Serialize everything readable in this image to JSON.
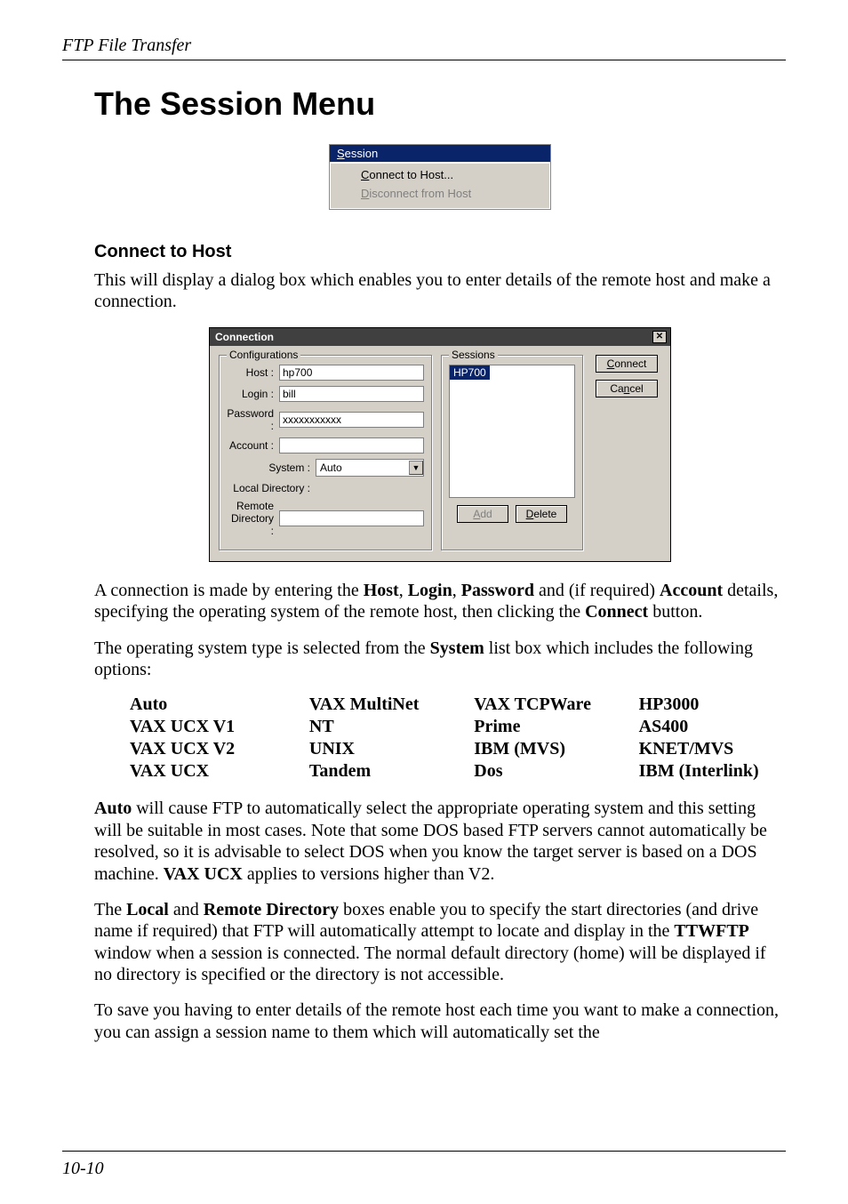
{
  "header": {
    "running": "FTP File Transfer"
  },
  "title": "The Session Menu",
  "menu": {
    "label": "Session",
    "items": [
      {
        "label_pre": "",
        "accel": "C",
        "label_post": "onnect to Host...",
        "disabled": false
      },
      {
        "label_pre": "",
        "accel": "D",
        "label_post": "isconnect from Host",
        "disabled": true
      }
    ]
  },
  "section1": {
    "heading": "Connect to Host",
    "intro": "This will display a dialog box which enables you to enter details of the remote host and make a connection."
  },
  "dialog": {
    "title": "Connection",
    "configurations_legend": "Configurations",
    "sessions_legend": "Sessions",
    "host_label": "Host :",
    "host_value": "hp700",
    "login_label": "Login :",
    "login_value": "bill",
    "password_label": "Password :",
    "password_value": "xxxxxxxxxxx",
    "account_label": "Account :",
    "account_value": "",
    "system_label": "System :",
    "system_value": "Auto",
    "localdir_label": "Local Directory :",
    "localdir_value": "",
    "remotedir_label": "Remote Directory :",
    "remotedir_value": "",
    "session_item": "HP700",
    "btn_add_pre": "",
    "btn_add_accel": "A",
    "btn_add_post": "dd",
    "btn_delete_pre": "",
    "btn_delete_accel": "D",
    "btn_delete_post": "elete",
    "btn_connect_pre": "",
    "btn_connect_accel": "C",
    "btn_connect_post": "onnect",
    "btn_cancel_pre": "Ca",
    "btn_cancel_accel": "n",
    "btn_cancel_post": "cel"
  },
  "para2": "A connection is made by entering the ",
  "para2_b1": "Host",
  "para2_m1": ", ",
  "para2_b2": "Login",
  "para2_m2": ", ",
  "para2_b3": "Password",
  "para2_m3": " and (if required) ",
  "para2_b4": "Account",
  "para2_m4": " details, specifying the operating system of the remote host, then clicking the ",
  "para2_b5": "Connect",
  "para2_m5": " button.",
  "para3a": "The operating system type is selected from the ",
  "para3b": "System",
  "para3c": " list box which includes the following options:",
  "options": {
    "r0": [
      "Auto",
      "VAX MultiNet",
      "VAX TCPWare",
      "HP3000"
    ],
    "r1": [
      "VAX UCX V1",
      "NT",
      "Prime",
      "AS400"
    ],
    "r2": [
      "VAX UCX V2",
      "UNIX",
      "IBM (MVS)",
      "KNET/MVS"
    ],
    "r3": [
      "VAX UCX",
      "Tandem",
      "Dos",
      "IBM (Interlink)"
    ]
  },
  "para4_b1": "Auto",
  "para4_m1": " will cause FTP to automatically select the appropriate operating system and this setting will be suitable in most cases. Note that some DOS based FTP servers cannot automatically be resolved, so it is advisable to select DOS when you know the target server is based on a DOS machine. ",
  "para4_b2": "VAX UCX",
  "para4_m2": " applies to versions higher than V2.",
  "para5_a": "The ",
  "para5_b1": "Local",
  "para5_m1": " and ",
  "para5_b2": "Remote Directory",
  "para5_m2": " boxes enable you to specify the start directories (and drive name if required) that FTP will automatically attempt to locate and display in the ",
  "para5_b3": "TTWFTP",
  "para5_m3": " window when a session is connected. The normal default directory (home) will be displayed if no directory is specified or the directory is not accessible.",
  "para6": "To save you having to enter details of the remote host each time you want to make a connection, you can assign a session name to them which will automatically set the",
  "footer": {
    "pagenum": "10-10"
  }
}
